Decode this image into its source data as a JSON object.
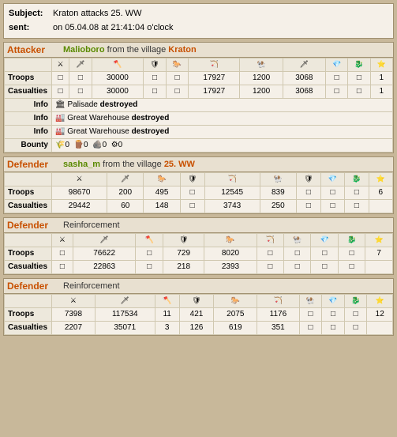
{
  "header": {
    "subject_label": "Subject:",
    "subject_value": "Kraton attacks 25. WW",
    "sent_label": "sent:",
    "sent_value": "on 05.04.08 at 21:41:04 o'clock"
  },
  "attacker": {
    "title": "Attacker",
    "player": "Malioboro",
    "from_text": "from the village",
    "village": "Kraton",
    "troops_label": "Troops",
    "casualties_label": "Casualties",
    "troops": [
      "",
      "",
      "30000",
      "",
      "",
      "17927",
      "1200",
      "3068",
      "",
      "",
      "1"
    ],
    "casualties": [
      "",
      "",
      "30000",
      "",
      "",
      "17927",
      "1200",
      "3068",
      "",
      "",
      "1"
    ],
    "info_rows": [
      {
        "label": "Info",
        "icon": "🏛",
        "text": "Palisade",
        "bold": "destroyed"
      },
      {
        "label": "Info",
        "icon": "🏭",
        "text": "Great Warehouse",
        "bold": "destroyed"
      },
      {
        "label": "Info",
        "icon": "🏭",
        "text": "Great Warehouse",
        "bold": "destroyed"
      }
    ],
    "bounty_label": "Bounty",
    "bounty_text": "0  0  0  0"
  },
  "defender1": {
    "title": "Defender",
    "player": "sasha_m",
    "from_text": "from the village",
    "village": "25. WW",
    "troops_label": "Troops",
    "casualties_label": "Casualties",
    "troops": [
      "98670",
      "200",
      "495",
      "",
      "12545",
      "839",
      "",
      "",
      "",
      "6"
    ],
    "casualties": [
      "29442",
      "60",
      "148",
      "",
      "3743",
      "250",
      "",
      "",
      "",
      ""
    ]
  },
  "defender2": {
    "title": "Defender",
    "section_info": "Reinforcement",
    "troops_label": "Troops",
    "casualties_label": "Casualties",
    "troops": [
      "",
      "76622",
      "",
      "729",
      "8020",
      "",
      "",
      "",
      "",
      "7"
    ],
    "casualties": [
      "",
      "22863",
      "",
      "218",
      "2393",
      "",
      "",
      "",
      "",
      ""
    ]
  },
  "defender3": {
    "title": "Defender",
    "section_info": "Reinforcement",
    "troops_label": "Troops",
    "casualties_label": "Casualties",
    "troops": [
      "7398",
      "117534",
      "11",
      "421",
      "2075",
      "1176",
      "",
      "",
      "",
      "12"
    ],
    "casualties": [
      "2207",
      "35071",
      "3",
      "126",
      "619",
      "351",
      "",
      "",
      "",
      ""
    ]
  },
  "icons": {
    "attacker_icons": [
      "🗡",
      "⚔",
      "🪓",
      "🛡",
      "🐎",
      "🏹",
      "🐏",
      "🗡",
      "🐉",
      "⭐",
      "⭐"
    ],
    "defender1_icons": [
      "🗡",
      "⚔",
      "🐎",
      "🛡",
      "🏹",
      "🐏",
      "🛡",
      "💎",
      "🐉",
      "⭐"
    ],
    "defender2_icons": [
      "🗡",
      "⚔",
      "🪓",
      "🛡",
      "🐎",
      "🏹",
      "🐏",
      "💎",
      "🐉",
      "⭐"
    ],
    "defender3_icons": [
      "🗡",
      "⚔",
      "🪓",
      "🛡",
      "🐎",
      "🏹",
      "🐏",
      "💎",
      "🐉",
      "⭐"
    ]
  }
}
